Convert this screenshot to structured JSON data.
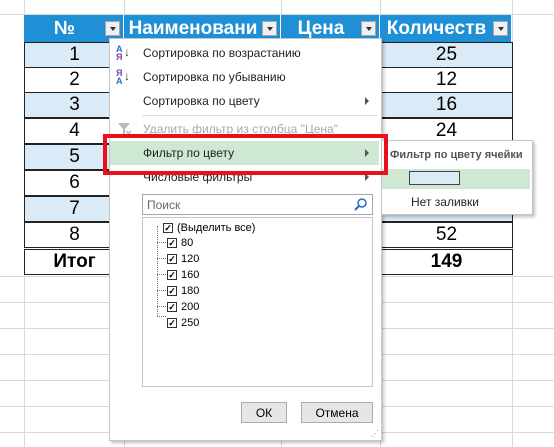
{
  "table": {
    "headers": [
      "№",
      "Наименовани",
      "Цена",
      "Количеств"
    ],
    "rows": [
      {
        "num": "1",
        "qty": "25",
        "style": "blue"
      },
      {
        "num": "2",
        "qty": "12",
        "style": "white"
      },
      {
        "num": "3",
        "qty": "16",
        "style": "blue"
      },
      {
        "num": "4",
        "qty": "24",
        "style": "white"
      },
      {
        "num": "5",
        "qty": "",
        "style": "blue"
      },
      {
        "num": "6",
        "qty": "",
        "style": "white"
      },
      {
        "num": "7",
        "qty": "",
        "style": "blue"
      },
      {
        "num": "8",
        "qty": "52",
        "style": "white"
      }
    ],
    "total_label": "Итог",
    "total_qty": "149"
  },
  "menu": {
    "sort_asc": "Сортировка по возрастанию",
    "sort_desc": "Сортировка по убыванию",
    "sort_color": "Сортировка по цвету",
    "remove_filter": "Удалить фильтр из столбца \"Цена\"",
    "filter_color": "Фильтр по цвету",
    "number_filters": "Числовые фильтры",
    "search_placeholder": "Поиск",
    "items": [
      "(Выделить все)",
      "80",
      "120",
      "160",
      "180",
      "200",
      "250"
    ],
    "ok": "ОК",
    "cancel": "Отмена"
  },
  "submenu": {
    "title": "Фильтр по цвету ячейки",
    "no_fill": "Нет заливки"
  },
  "colors": {
    "header_bg": "#1f8fd6",
    "row_blue": "#dbeaf7",
    "highlight": "#cfe8d3",
    "red_frame": "#e8101a"
  }
}
